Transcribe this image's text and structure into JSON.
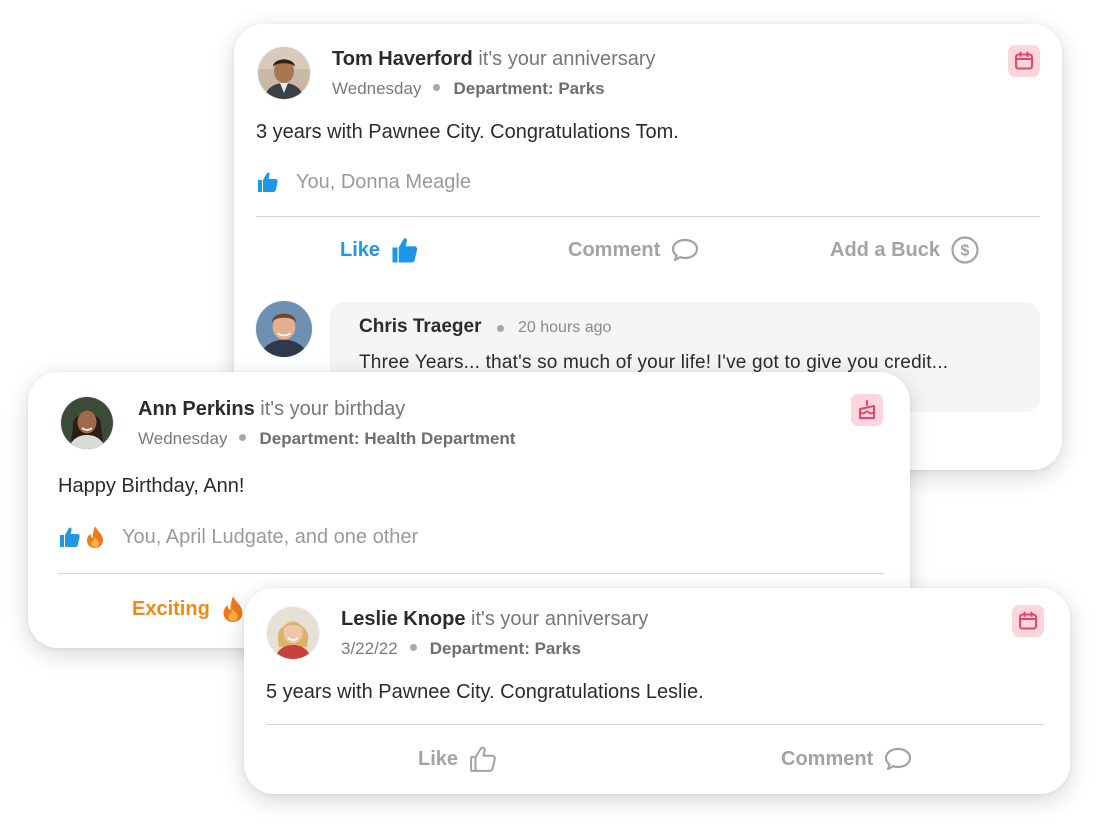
{
  "posts": [
    {
      "author": "Tom Haverford",
      "event": "it's your anniversary",
      "day": "Wednesday",
      "department": "Department: Parks",
      "badge_icon": "calendar-icon",
      "message": "3 years with Pawnee City. Congratulations Tom.",
      "reactions": "You, Donna Meagle",
      "actions": {
        "like": "Like",
        "comment": "Comment",
        "buck": "Add a Buck"
      },
      "comment": {
        "author": "Chris Traeger",
        "time": "20 hours ago",
        "text": "Three Years... that's so much of your life! I've got to give you credit..."
      }
    },
    {
      "author": "Ann Perkins",
      "event": "it's your birthday",
      "day": "Wednesday",
      "department": "Department: Health Department",
      "badge_icon": "birthday-cake-icon",
      "message": "Happy Birthday, Ann!",
      "reactions": "You, April Ludgate, and one other",
      "actions": {
        "exciting": "Exciting"
      }
    },
    {
      "author": "Leslie Knope",
      "event": "it's your anniversary",
      "day": "3/22/22",
      "department": "Department: Parks",
      "badge_icon": "calendar-icon",
      "message": "5 years with Pawnee City. Congratulations Leslie.",
      "actions": {
        "like": "Like",
        "comment": "Comment"
      }
    }
  ],
  "colors": {
    "like_active": "#1e98e6",
    "exciting": "#f08a14",
    "badge_bg": "#fbd7dd",
    "badge_icon": "#e8436a",
    "muted": "#a3a3a3"
  }
}
